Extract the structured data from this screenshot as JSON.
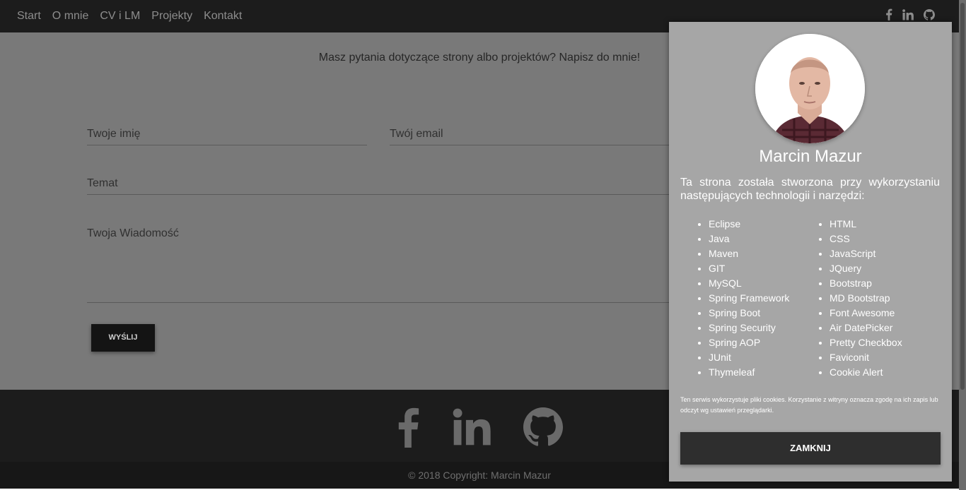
{
  "nav": {
    "links": [
      "Start",
      "O mnie",
      "CV i LM",
      "Projekty",
      "Kontakt"
    ],
    "social_icons": [
      "facebook-icon",
      "linkedin-icon",
      "github-icon"
    ]
  },
  "contact": {
    "intro": "Masz pytania dotyczące strony albo projektów? Napisz do mnie!",
    "name_placeholder": "Twoje imię",
    "email_placeholder": "Twój email",
    "subject_placeholder": "Temat",
    "message_placeholder": "Twoja Wiadomość",
    "send_label": "WYŚLIJ"
  },
  "footer": {
    "social_icons": [
      "facebook-icon",
      "linkedin-icon",
      "github-icon"
    ],
    "copyright": "© 2018 Copyright: Marcin Mazur"
  },
  "panel": {
    "name": "Marcin Mazur",
    "description": "Ta strona została stworzona przy wykorzystaniu następujących technologii i narzędzi:",
    "tech_left": [
      "Eclipse",
      "Java",
      "Maven",
      "GIT",
      "MySQL",
      "Spring Framework",
      "Spring Boot",
      "Spring Security",
      "Spring AOP",
      "JUnit",
      "Thymeleaf"
    ],
    "tech_right": [
      "HTML",
      "CSS",
      "JavaScript",
      "JQuery",
      "Bootstrap",
      "MD Bootstrap",
      "Font Awesome",
      "Air DatePicker",
      "Pretty Checkbox",
      "Faviconit",
      "Cookie Alert"
    ],
    "cookie_text": "Ten serwis wykorzystuje pliki cookies. Korzystanie z witryny oznacza zgodę na ich zapis lub odczyt wg ustawień przeglądarki.",
    "close_label": "ZAMKNIJ"
  },
  "colors": {
    "navbar": "#1c1c1c",
    "overlay_bg": "#797979",
    "panel_bg": "#a6a6a6",
    "button_dark": "#141414"
  }
}
